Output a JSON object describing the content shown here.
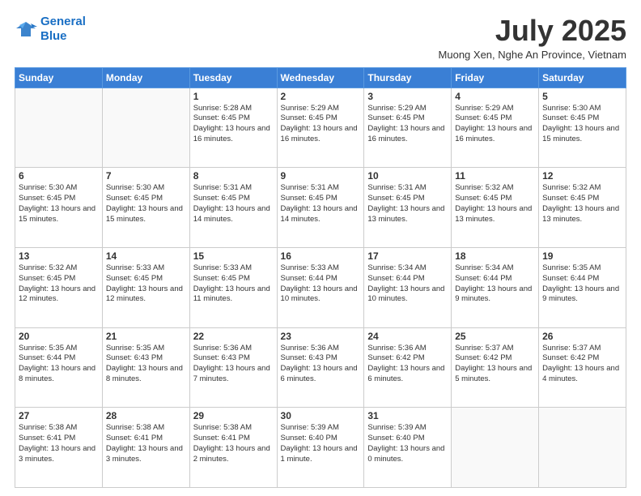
{
  "logo": {
    "line1": "General",
    "line2": "Blue"
  },
  "title": "July 2025",
  "location": "Muong Xen, Nghe An Province, Vietnam",
  "days_of_week": [
    "Sunday",
    "Monday",
    "Tuesday",
    "Wednesday",
    "Thursday",
    "Friday",
    "Saturday"
  ],
  "weeks": [
    [
      {
        "day": "",
        "info": ""
      },
      {
        "day": "",
        "info": ""
      },
      {
        "day": "1",
        "info": "Sunrise: 5:28 AM\nSunset: 6:45 PM\nDaylight: 13 hours and 16 minutes."
      },
      {
        "day": "2",
        "info": "Sunrise: 5:29 AM\nSunset: 6:45 PM\nDaylight: 13 hours and 16 minutes."
      },
      {
        "day": "3",
        "info": "Sunrise: 5:29 AM\nSunset: 6:45 PM\nDaylight: 13 hours and 16 minutes."
      },
      {
        "day": "4",
        "info": "Sunrise: 5:29 AM\nSunset: 6:45 PM\nDaylight: 13 hours and 16 minutes."
      },
      {
        "day": "5",
        "info": "Sunrise: 5:30 AM\nSunset: 6:45 PM\nDaylight: 13 hours and 15 minutes."
      }
    ],
    [
      {
        "day": "6",
        "info": "Sunrise: 5:30 AM\nSunset: 6:45 PM\nDaylight: 13 hours and 15 minutes."
      },
      {
        "day": "7",
        "info": "Sunrise: 5:30 AM\nSunset: 6:45 PM\nDaylight: 13 hours and 15 minutes."
      },
      {
        "day": "8",
        "info": "Sunrise: 5:31 AM\nSunset: 6:45 PM\nDaylight: 13 hours and 14 minutes."
      },
      {
        "day": "9",
        "info": "Sunrise: 5:31 AM\nSunset: 6:45 PM\nDaylight: 13 hours and 14 minutes."
      },
      {
        "day": "10",
        "info": "Sunrise: 5:31 AM\nSunset: 6:45 PM\nDaylight: 13 hours and 13 minutes."
      },
      {
        "day": "11",
        "info": "Sunrise: 5:32 AM\nSunset: 6:45 PM\nDaylight: 13 hours and 13 minutes."
      },
      {
        "day": "12",
        "info": "Sunrise: 5:32 AM\nSunset: 6:45 PM\nDaylight: 13 hours and 13 minutes."
      }
    ],
    [
      {
        "day": "13",
        "info": "Sunrise: 5:32 AM\nSunset: 6:45 PM\nDaylight: 13 hours and 12 minutes."
      },
      {
        "day": "14",
        "info": "Sunrise: 5:33 AM\nSunset: 6:45 PM\nDaylight: 13 hours and 12 minutes."
      },
      {
        "day": "15",
        "info": "Sunrise: 5:33 AM\nSunset: 6:45 PM\nDaylight: 13 hours and 11 minutes."
      },
      {
        "day": "16",
        "info": "Sunrise: 5:33 AM\nSunset: 6:44 PM\nDaylight: 13 hours and 10 minutes."
      },
      {
        "day": "17",
        "info": "Sunrise: 5:34 AM\nSunset: 6:44 PM\nDaylight: 13 hours and 10 minutes."
      },
      {
        "day": "18",
        "info": "Sunrise: 5:34 AM\nSunset: 6:44 PM\nDaylight: 13 hours and 9 minutes."
      },
      {
        "day": "19",
        "info": "Sunrise: 5:35 AM\nSunset: 6:44 PM\nDaylight: 13 hours and 9 minutes."
      }
    ],
    [
      {
        "day": "20",
        "info": "Sunrise: 5:35 AM\nSunset: 6:44 PM\nDaylight: 13 hours and 8 minutes."
      },
      {
        "day": "21",
        "info": "Sunrise: 5:35 AM\nSunset: 6:43 PM\nDaylight: 13 hours and 8 minutes."
      },
      {
        "day": "22",
        "info": "Sunrise: 5:36 AM\nSunset: 6:43 PM\nDaylight: 13 hours and 7 minutes."
      },
      {
        "day": "23",
        "info": "Sunrise: 5:36 AM\nSunset: 6:43 PM\nDaylight: 13 hours and 6 minutes."
      },
      {
        "day": "24",
        "info": "Sunrise: 5:36 AM\nSunset: 6:42 PM\nDaylight: 13 hours and 6 minutes."
      },
      {
        "day": "25",
        "info": "Sunrise: 5:37 AM\nSunset: 6:42 PM\nDaylight: 13 hours and 5 minutes."
      },
      {
        "day": "26",
        "info": "Sunrise: 5:37 AM\nSunset: 6:42 PM\nDaylight: 13 hours and 4 minutes."
      }
    ],
    [
      {
        "day": "27",
        "info": "Sunrise: 5:38 AM\nSunset: 6:41 PM\nDaylight: 13 hours and 3 minutes."
      },
      {
        "day": "28",
        "info": "Sunrise: 5:38 AM\nSunset: 6:41 PM\nDaylight: 13 hours and 3 minutes."
      },
      {
        "day": "29",
        "info": "Sunrise: 5:38 AM\nSunset: 6:41 PM\nDaylight: 13 hours and 2 minutes."
      },
      {
        "day": "30",
        "info": "Sunrise: 5:39 AM\nSunset: 6:40 PM\nDaylight: 13 hours and 1 minute."
      },
      {
        "day": "31",
        "info": "Sunrise: 5:39 AM\nSunset: 6:40 PM\nDaylight: 13 hours and 0 minutes."
      },
      {
        "day": "",
        "info": ""
      },
      {
        "day": "",
        "info": ""
      }
    ]
  ]
}
